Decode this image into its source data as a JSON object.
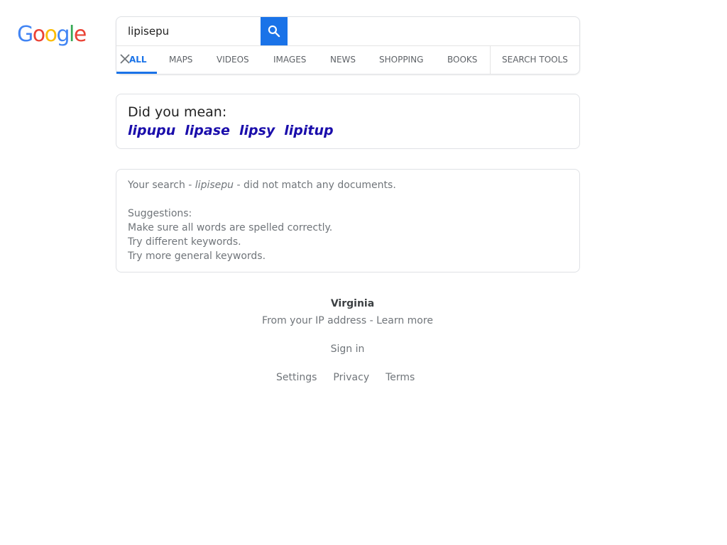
{
  "logo": {
    "letters": [
      "G",
      "o",
      "o",
      "g",
      "l",
      "e"
    ],
    "colors": [
      "#4285F4",
      "#EA4335",
      "#FBBC05",
      "#4285F4",
      "#34A853",
      "#EA4335"
    ]
  },
  "search": {
    "value": "lipisepu",
    "button_icon": "search-icon",
    "button_color": "#1a73e8"
  },
  "tabs": [
    {
      "label": "ALL",
      "active": true
    },
    {
      "label": "MAPS"
    },
    {
      "label": "VIDEOS"
    },
    {
      "label": "IMAGES"
    },
    {
      "label": "NEWS"
    },
    {
      "label": "SHOPPING"
    },
    {
      "label": "BOOKS"
    },
    {
      "label": "SEARCH TOOLS"
    }
  ],
  "did_you_mean": {
    "title": "Did you mean:",
    "suggestions": [
      "lipupu",
      "lipase",
      "lipsy",
      "lipitup"
    ],
    "link_color": "#1a0dab"
  },
  "no_results": {
    "prefix": "Your search - ",
    "query": "lipisepu",
    "suffix": " - did not match any documents.",
    "suggestions_label": "Suggestions:",
    "tips": [
      "Make sure all words are spelled correctly.",
      "Try different keywords.",
      "Try more general keywords."
    ]
  },
  "footer": {
    "location": "Virginia",
    "ip_text": "From your IP address - ",
    "learn_more": "Learn more",
    "sign_in": "Sign in",
    "links": [
      "Settings",
      "Privacy",
      "Terms"
    ]
  }
}
